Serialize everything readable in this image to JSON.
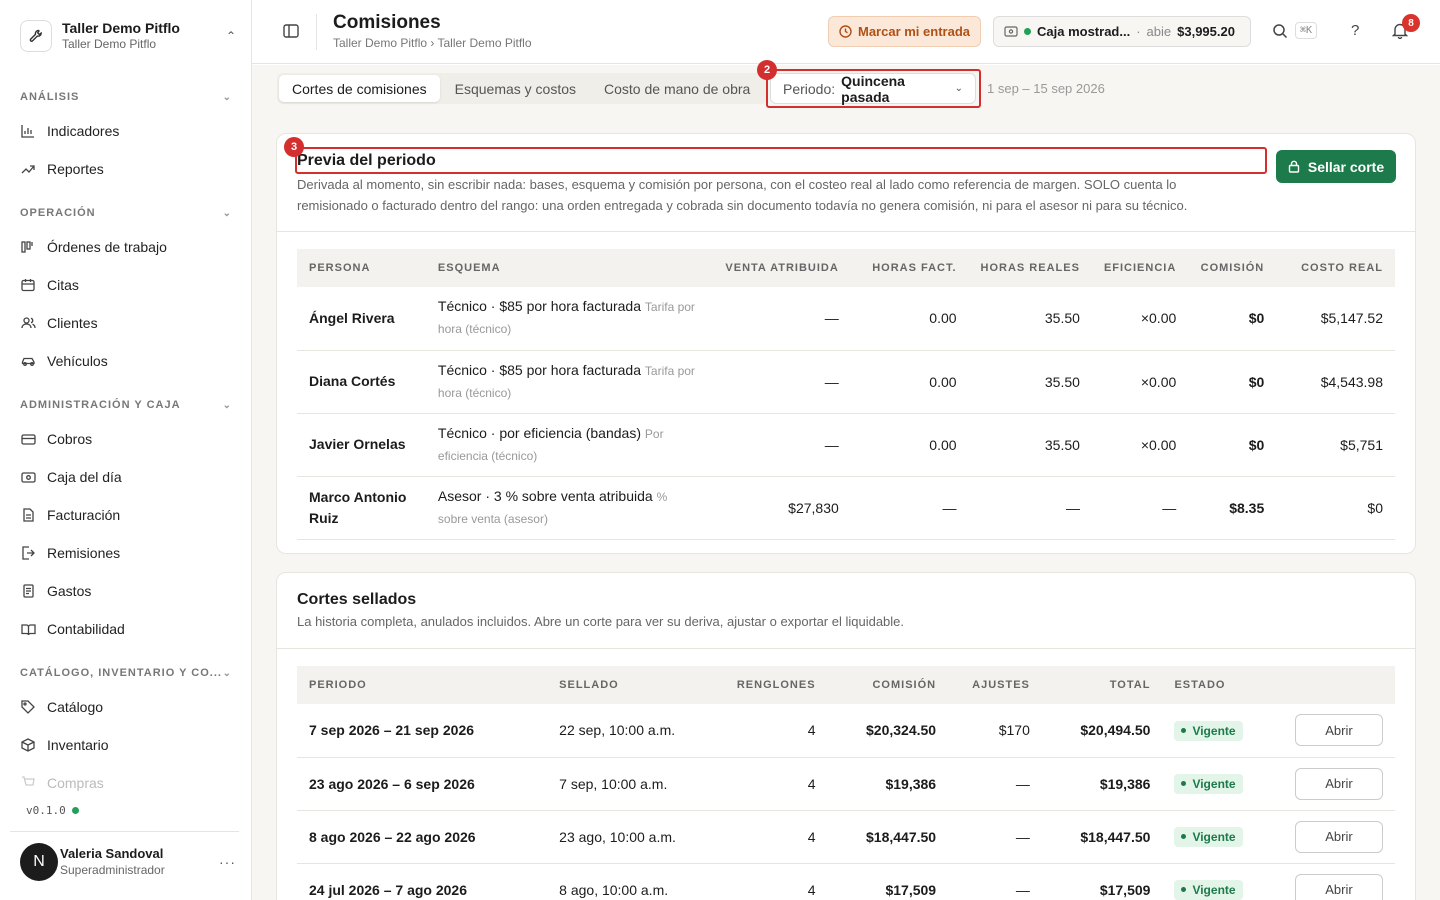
{
  "org": {
    "name": "Taller Demo Pitflo",
    "subtitle": "Taller Demo Pitflo"
  },
  "sidebar": {
    "sections": [
      {
        "label": "ANÁLISIS"
      },
      {
        "label": "OPERACIÓN"
      },
      {
        "label": "ADMINISTRACIÓN Y CAJA"
      },
      {
        "label": "CATÁLOGO, INVENTARIO Y CO..."
      }
    ],
    "items": [
      {
        "label": "Indicadores",
        "icon": "bar-chart-icon"
      },
      {
        "label": "Reportes",
        "icon": "trend-icon"
      },
      {
        "label": "Órdenes de trabajo",
        "icon": "work-order-icon"
      },
      {
        "label": "Citas",
        "icon": "calendar-icon"
      },
      {
        "label": "Clientes",
        "icon": "users-icon"
      },
      {
        "label": "Vehículos",
        "icon": "car-icon"
      },
      {
        "label": "Cobros",
        "icon": "card-icon"
      },
      {
        "label": "Caja del día",
        "icon": "register-icon"
      },
      {
        "label": "Facturación",
        "icon": "invoice-icon"
      },
      {
        "label": "Remisiones",
        "icon": "remission-icon"
      },
      {
        "label": "Gastos",
        "icon": "receipt-icon"
      },
      {
        "label": "Contabilidad",
        "icon": "book-icon"
      },
      {
        "label": "Catálogo",
        "icon": "tag-icon"
      },
      {
        "label": "Inventario",
        "icon": "box-icon"
      },
      {
        "label": "Compras",
        "icon": "cart-icon"
      }
    ],
    "version": "v0.1.0"
  },
  "user": {
    "initial": "N",
    "name": "Valeria Sandoval",
    "role": "Superadministrador"
  },
  "header": {
    "title": "Comisiones",
    "breadcrumb": "Taller Demo Pitflo › Taller Demo Pitflo",
    "clock_in_label": "Marcar mi entrada",
    "cash": {
      "name": "Caja mostrad...",
      "separator": "·",
      "status": "abie",
      "amount": "$3,995.20"
    },
    "shortcut": "⌘K",
    "help": "?",
    "notifications": "8"
  },
  "tabs": [
    "Cortes de comisiones",
    "Esquemas y costos",
    "Costo de mano de obra"
  ],
  "period": {
    "label": "Periodo:",
    "value": "Quincena pasada",
    "range": "1 sep – 15 sep 2026"
  },
  "markers": {
    "period": "2",
    "preview": "3"
  },
  "preview": {
    "title": "Previa del periodo",
    "description": "Derivada al momento, sin escribir nada: bases, esquema y comisión por persona, con el costeo real al lado como referencia de margen. SOLO cuenta lo remisionado o facturado dentro del rango: una orden entregada y cobrada sin documento todavía no genera comisión, ni para el asesor ni para su técnico.",
    "seal_label": "Sellar corte",
    "columns": [
      "PERSONA",
      "ESQUEMA",
      "VENTA ATRIBUIDA",
      "HORAS FACT.",
      "HORAS REALES",
      "EFICIENCIA",
      "COMISIÓN",
      "COSTO REAL"
    ],
    "rows": [
      {
        "person": "Ángel Rivera",
        "scheme": "Técnico · $85 por hora facturada",
        "scheme_sub": "Tarifa por hora (técnico)",
        "sales": "—",
        "billed": "0.00",
        "real": "35.50",
        "eff": "×0.00",
        "commission": "$0",
        "cost": "$5,147.52"
      },
      {
        "person": "Diana Cortés",
        "scheme": "Técnico · $85 por hora facturada",
        "scheme_sub": "Tarifa por hora (técnico)",
        "sales": "—",
        "billed": "0.00",
        "real": "35.50",
        "eff": "×0.00",
        "commission": "$0",
        "cost": "$4,543.98"
      },
      {
        "person": "Javier Ornelas",
        "scheme": "Técnico · por eficiencia (bandas)",
        "scheme_sub": "Por eficiencia (técnico)",
        "sales": "—",
        "billed": "0.00",
        "real": "35.50",
        "eff": "×0.00",
        "commission": "$0",
        "cost": "$5,751"
      },
      {
        "person": "Marco Antonio Ruiz",
        "scheme": "Asesor · 3 % sobre venta atribuida",
        "scheme_sub": "% sobre venta (asesor)",
        "sales": "$27,830",
        "billed": "—",
        "real": "—",
        "eff": "—",
        "commission": "$8.35",
        "cost": "$0"
      }
    ]
  },
  "sealed": {
    "title": "Cortes sellados",
    "description": "La historia completa, anulados incluidos. Abre un corte para ver su deriva, ajustar o exportar el liquidable.",
    "columns": [
      "PERIODO",
      "SELLADO",
      "RENGLONES",
      "COMISIÓN",
      "AJUSTES",
      "TOTAL",
      "ESTADO",
      ""
    ],
    "open_label": "Abrir",
    "rows": [
      {
        "period": "7 sep 2026 – 21 sep 2026",
        "sealed": "22 sep, 10:00 a.m.",
        "lines": "4",
        "commission": "$20,324.50",
        "adjust": "$170",
        "total": "$20,494.50",
        "status": "Vigente"
      },
      {
        "period": "23 ago 2026 – 6 sep 2026",
        "sealed": "7 sep, 10:00 a.m.",
        "lines": "4",
        "commission": "$19,386",
        "adjust": "—",
        "total": "$19,386",
        "status": "Vigente"
      },
      {
        "period": "8 ago 2026 – 22 ago 2026",
        "sealed": "23 ago, 10:00 a.m.",
        "lines": "4",
        "commission": "$18,447.50",
        "adjust": "—",
        "total": "$18,447.50",
        "status": "Vigente"
      },
      {
        "period": "24 jul 2026 – 7 ago 2026",
        "sealed": "8 ago, 10:00 a.m.",
        "lines": "4",
        "commission": "$17,509",
        "adjust": "—",
        "total": "$17,509",
        "status": "Vigente"
      }
    ]
  },
  "colors": {
    "accent": "#1d7a4a",
    "highlight": "#d32f2f",
    "clock_in": "#b05015"
  }
}
